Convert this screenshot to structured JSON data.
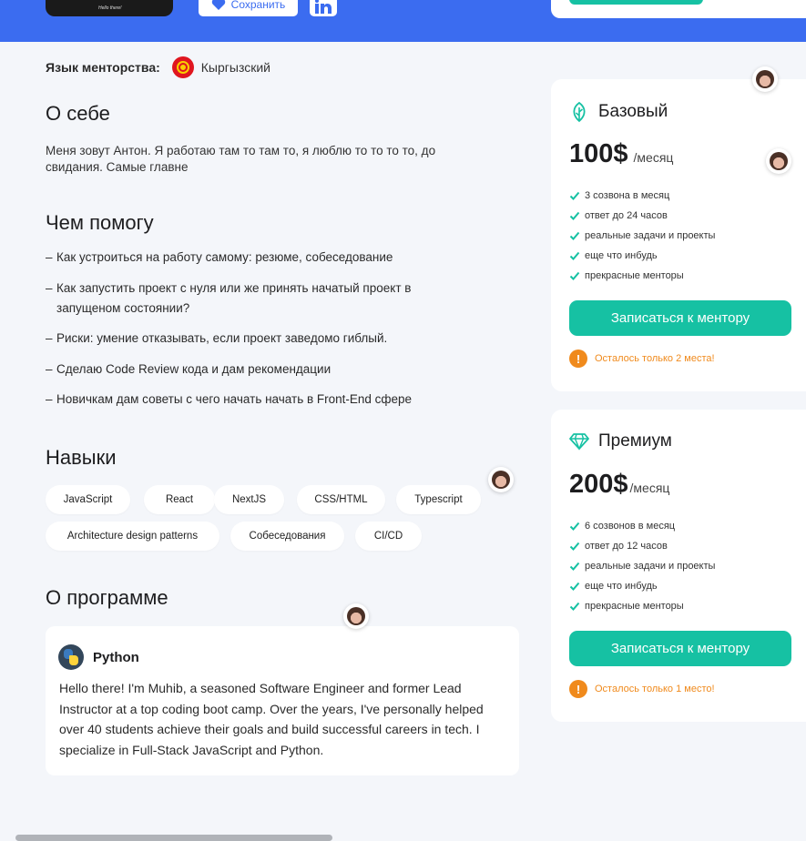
{
  "header": {
    "save_label": "Сохранить",
    "shirt_text": "Hello there!",
    "colors": {
      "band": "#3b6cf0",
      "accent": "#16c1a3"
    }
  },
  "mentor_language": {
    "label": "Язык менторства:",
    "value": "Кыргызский",
    "flag_icon": "kyrgyzstan-flag-icon"
  },
  "about": {
    "title": "О себе",
    "text": "Меня зовут Антон. Я работаю там то там то, я люблю то то то то, до свидания. Самые главне"
  },
  "help": {
    "title": "Чем помогу",
    "items": [
      "Как устроиться на работу самому: резюме, собеседование",
      "Как запустить проект с нуля или же принять начатый проект в запущеном состоянии?",
      "Риски: умение отказывать, если проект заведомо гиблый.",
      "Сделаю Code Review кода и дам рекомендации",
      "Новичкам дам советы с чего начать начать в Front-End сфере"
    ]
  },
  "skills": {
    "title": "Навыки",
    "chips": [
      "JavaScript",
      "React",
      "NextJS",
      "CSS/HTML",
      "Typescript",
      "Architecture design patterns",
      "Собеседования",
      "CI/CD"
    ]
  },
  "program": {
    "title": "О программе",
    "name": "Python",
    "text": "Hello there! I'm Muhib, a seasoned Software Engineer and former Lead Instructor at a top coding boot camp. Over the years, I've personally helped over 40 students achieve their goals and build successful careers in tech. I specialize in Full-Stack JavaScript and Python."
  },
  "plans": [
    {
      "name": "Базовый",
      "icon": "leaf-icon",
      "price": "100$",
      "period": "/месяц",
      "features": [
        "3 созвона в месяц",
        "ответ до 24 часов",
        "реальные задачи и проекты",
        "еще что инбудь",
        "прекрасные менторы"
      ],
      "cta": "Записаться к ментору",
      "warning": "Осталось только 2 места!"
    },
    {
      "name": "Премиум",
      "icon": "diamond-icon",
      "price": "200$",
      "period": "/месяц",
      "features": [
        "6 созвонов в месяц",
        "ответ до 12 часов",
        "реальные задачи и проекты",
        "еще что инбудь",
        "прекрасные менторы"
      ],
      "cta": "Записаться к ментору",
      "warning": "Осталось только 1 место!"
    }
  ]
}
